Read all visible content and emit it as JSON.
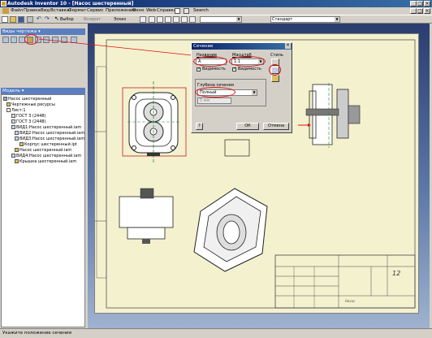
{
  "window": {
    "title": "Autodesk Inventor 10 - [Насос шестеренный]"
  },
  "menu": [
    "Файл",
    "Правка",
    "Вид",
    "Вставка",
    "Формат",
    "Сервис",
    "Приложения",
    "Окно",
    "Web",
    "Справка"
  ],
  "toolbar": {
    "select_label": "Выбор",
    "return_label": "Возврат",
    "sketch_label": "Эскиз",
    "search_label": "Search",
    "style_combo": "Стандарт"
  },
  "views_panel": {
    "title": "Виды чертежа"
  },
  "browser": {
    "title": "Модель",
    "items": [
      {
        "label": "Насос шестеренный",
        "level": 0
      },
      {
        "label": "Чертежные ресурсы",
        "level": 1
      },
      {
        "label": "Лист:1",
        "level": 1
      },
      {
        "label": "ГОСТ 3 (2448)",
        "level": 2
      },
      {
        "label": "ГОСТ 3 (2448)",
        "level": 2
      },
      {
        "label": "ВИД1:Насос шестеренный.iam",
        "level": 2
      },
      {
        "label": "ВИД2:Насос шестеренный.iam",
        "level": 3
      },
      {
        "label": "ВИД3:Насос шестеренный.iam",
        "level": 3
      },
      {
        "label": "Корпус шестеренный.ipt",
        "level": 4
      },
      {
        "label": "Насос шестеренный.iam",
        "level": 3
      },
      {
        "label": "ВИД4:Насос шестеренный.iam",
        "level": 2
      },
      {
        "label": "Крышка шестеренный.iam",
        "level": 3
      }
    ]
  },
  "dialog": {
    "title": "Сечение",
    "name_label": "Название",
    "name_value": "А",
    "scale_label": "Масштаб",
    "scale_value": "1:1",
    "style_label": "Стиль",
    "visibility_label": "Видимость",
    "visibility2_label": "Видимость",
    "depth_label": "Глубина сечения",
    "depth_value": "Полный",
    "distance_value": "5 мм",
    "ok_label": "ОК",
    "cancel_label": "Отмена",
    "help_label": "?"
  },
  "title_block": {
    "sheet_label": "12",
    "code": "Насос"
  },
  "status": {
    "text": "Укажите положение сечения"
  },
  "colors": {
    "annotation": "#e01010",
    "accent_titlebar": "#0a246a"
  }
}
